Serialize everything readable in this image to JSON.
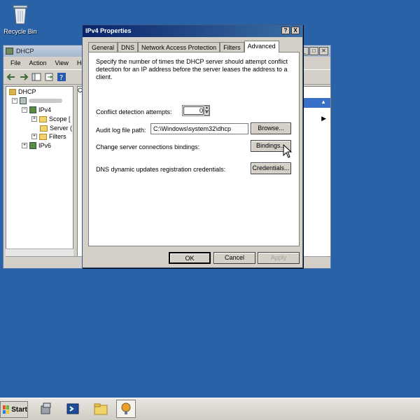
{
  "desktop": {
    "icon_label": "Recycle Bin"
  },
  "dhcp_window": {
    "title": "DHCP",
    "menu": [
      "File",
      "Action",
      "View",
      "Hel"
    ],
    "tree": {
      "root": "DHCP",
      "ipv4": "IPv4",
      "scope": "Scope [",
      "server": "Server (",
      "filters": "Filters",
      "ipv6": "IPv6"
    },
    "right_col_header": "Co"
  },
  "dialog": {
    "title": "IPv4 Properties",
    "help_button": "?",
    "close_button": "X",
    "tabs": [
      "General",
      "DNS",
      "Network Access Protection",
      "Filters",
      "Advanced"
    ],
    "active_tab": "Advanced",
    "description": "Specify the number of times the DHCP server should attempt conflict detection for an IP address before the server leases the address to a client.",
    "conflict_label": "Conflict detection attempts:",
    "conflict_value": "0",
    "audit_label": "Audit log file path:",
    "audit_value": "C:\\Windows\\system32\\dhcp",
    "browse_label": "Browse...",
    "bindings_text": "Change server connections bindings:",
    "bindings_label": "Bindings...",
    "dns_text": "DNS dynamic updates registration credentials:",
    "credentials_label": "Credentials...",
    "ok_label": "OK",
    "cancel_label": "Cancel",
    "apply_label": "Apply"
  },
  "taskbar": {
    "start_label": "Start"
  }
}
